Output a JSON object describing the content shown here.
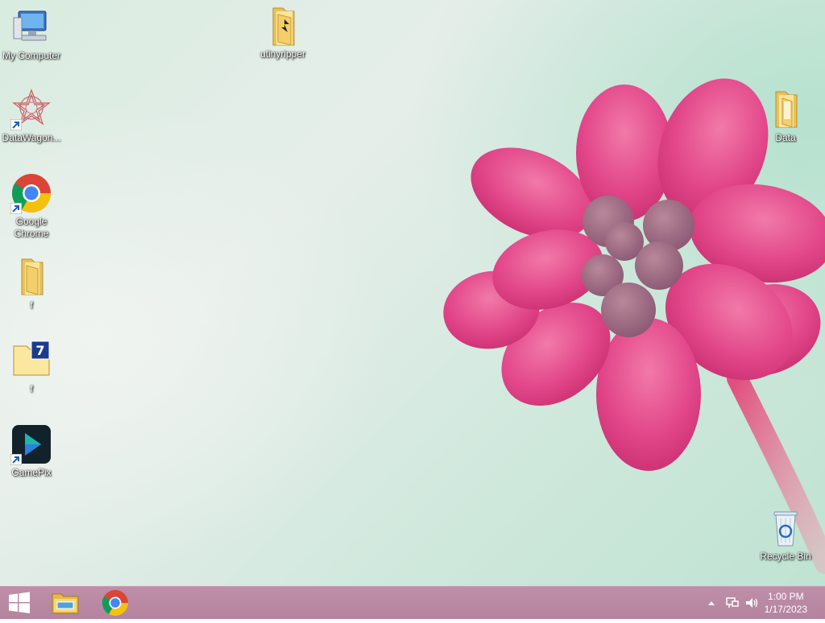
{
  "desktop": {
    "icons": [
      {
        "label": "My Computer",
        "icon": "my-computer-icon"
      },
      {
        "label": "DataWagon...",
        "icon": "datawagon-icon"
      },
      {
        "label": "Google Chrome",
        "icon": "chrome-icon"
      },
      {
        "label": "f",
        "icon": "folder-icon"
      },
      {
        "label": "f",
        "icon": "7zip-archive-icon"
      },
      {
        "label": "GamePix",
        "icon": "gamepix-icon"
      },
      {
        "label": "utinyripper",
        "icon": "folder-icon"
      },
      {
        "label": "Data",
        "icon": "folder-icon"
      },
      {
        "label": "Recycle Bin",
        "icon": "recycle-bin-icon"
      }
    ]
  },
  "taskbar": {
    "pinned": [
      {
        "name": "File Explorer",
        "icon": "file-explorer-icon"
      },
      {
        "name": "Google Chrome",
        "icon": "chrome-icon"
      }
    ],
    "clock": {
      "time": "1:00 PM",
      "date": "1/17/2023"
    }
  },
  "colors": {
    "taskbar": "#b4849f",
    "flower": "#e0457f",
    "wallpaper": "#d8ecdf"
  }
}
